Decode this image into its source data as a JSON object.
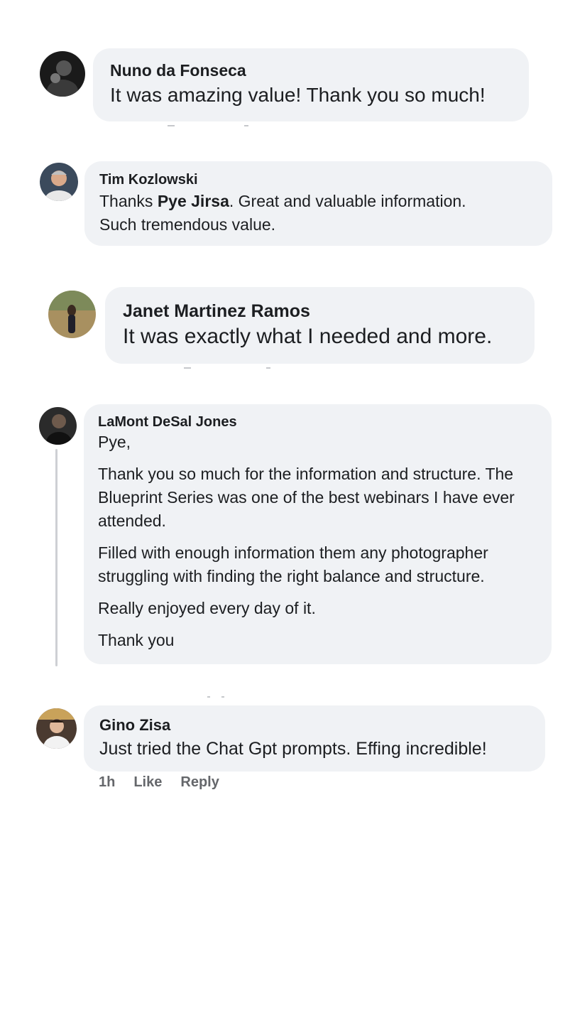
{
  "comments": [
    {
      "author": "Nuno da Fonseca",
      "text": "It was amazing value! Thank you so much!"
    },
    {
      "author": "Tim Kozlowski",
      "text_before": "Thanks ",
      "mention": "Pye Jirsa",
      "text_after": ". Great and valuable information.",
      "text_line2": "Such tremendous value."
    },
    {
      "author": "Janet Martinez Ramos",
      "text": "It was exactly what I needed and more."
    },
    {
      "author": "LaMont DeSal Jones",
      "paragraphs": [
        "Pye,",
        "Thank you so much for the information and structure. The Blueprint Series was one of the best webinars I have ever attended.",
        "Filled with enough information them any photographer struggling with finding the right balance and structure.",
        "Really enjoyed every day of it.",
        "Thank you"
      ]
    },
    {
      "author": "Gino Zisa",
      "text": "Just tried the Chat Gpt prompts. Effing incredible!",
      "time": "1h",
      "like_label": "Like",
      "reply_label": "Reply"
    }
  ],
  "colors": {
    "bubble": "#f0f2f5",
    "text": "#1c1e21",
    "meta": "#65676b",
    "thread_line": "#ced0d4"
  }
}
